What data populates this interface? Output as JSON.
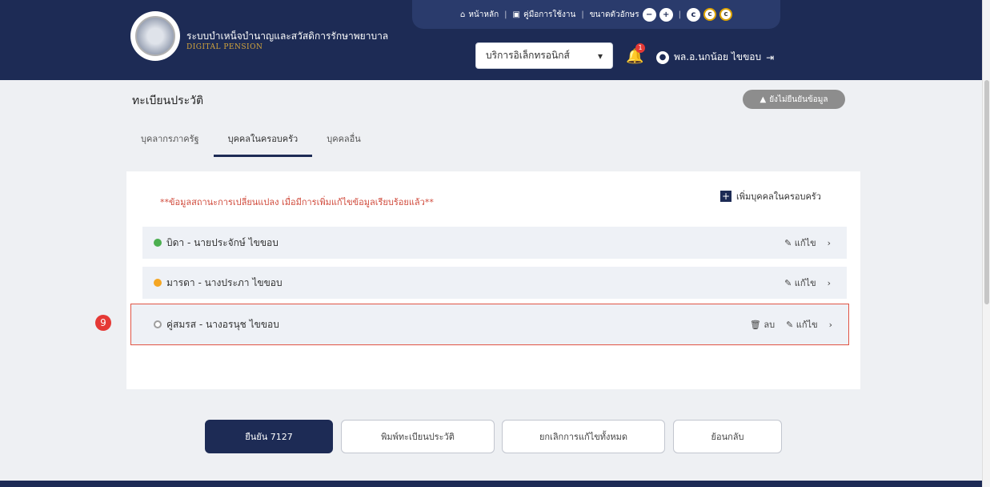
{
  "header": {
    "system_title": "ระบบบำเหน็จบำนาญและสวัสดิการรักษาพยาบาล",
    "system_subtitle": "DIGITAL PENSION",
    "top_links": {
      "home": "หน้าหลัก",
      "manual": "คู่มือการใช้งาน",
      "font_size": "ขนาดตัวอักษร"
    },
    "service_select": "บริการอิเล็กทรอนิกส์",
    "notification_count": "1",
    "user_name": "พล.อ.นกน้อย ไขขอบ"
  },
  "page": {
    "title": "ทะเบียนประวัติ",
    "status_button": "ยังไม่ยืนยันข้อมูล",
    "tabs": [
      {
        "label": "บุคลากรภาครัฐ"
      },
      {
        "label": "บุคคลในครอบครัว"
      },
      {
        "label": "บุคคลอื่น"
      }
    ],
    "note": "**ข้อมูลสถานะการเปลี่ยนแปลง เมื่อมีการเพิ่มแก้ไขข้อมูลเรียบร้อยแล้ว**",
    "add_button": "เพิ่มบุคคลในครอบครัว",
    "rows": [
      {
        "label": "บิดา - นายประจักษ์ ไขขอบ",
        "status_color": "#4caf50",
        "edit": "แก้ไข"
      },
      {
        "label": "มารดา - นางประภา ไขขอบ",
        "status_color": "#f5a623",
        "edit": "แก้ไข"
      },
      {
        "label": "คู่สมรส - นางอรนุช ไขขอบ",
        "status_color": "#9e9e9e",
        "edit": "แก้ไข",
        "delete": "ลบ"
      }
    ],
    "step_badge": "9"
  },
  "buttons": {
    "confirm": "ยืนยัน 7127",
    "print_record": "พิมพ์ทะเบียนประวัติ",
    "history": "ยกเลิกการแก้ไขทั้งหมด",
    "back": "ย้อนกลับ"
  }
}
